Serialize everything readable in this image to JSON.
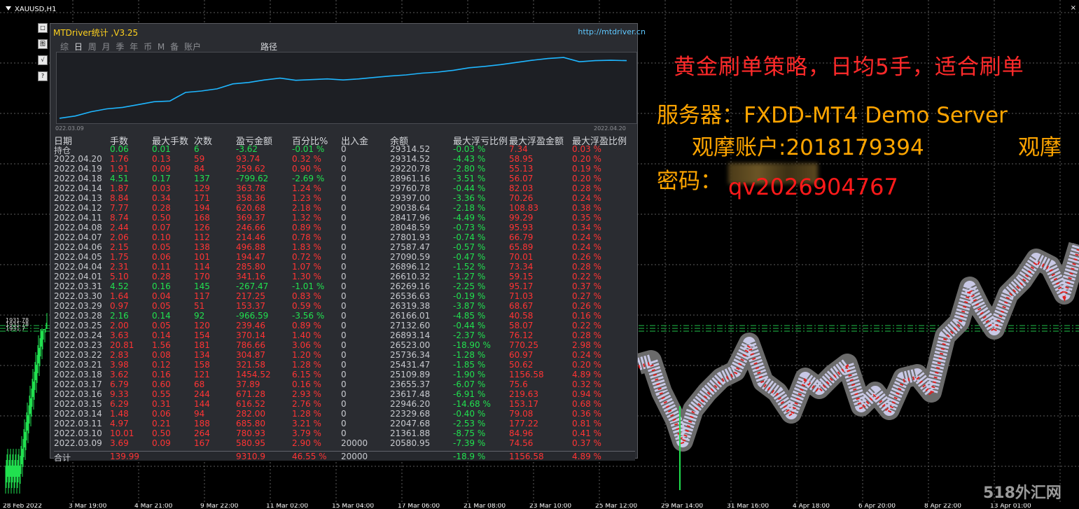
{
  "window": {
    "symbol_title": "XAUUSD,H1",
    "close": "×"
  },
  "side_buttons": [
    "□",
    "图",
    "√",
    "?"
  ],
  "panel": {
    "title": "MTDriver统计 ,V3.25",
    "link": "http://mtdriver.cn",
    "tabs": [
      "综",
      "日",
      "周",
      "月",
      "季",
      "年",
      "币",
      "M",
      "备",
      "账户"
    ],
    "active_tab": "日",
    "route_label": "路径",
    "equity_start": "022.03.09",
    "equity_end": "2022.04.20",
    "equity_curve": [
      20580,
      20900,
      21500,
      21900,
      22100,
      22500,
      22900,
      23000,
      24200,
      24400,
      24700,
      25400,
      25600,
      25950,
      26200,
      25900,
      26000,
      26100,
      25950,
      26100,
      26300,
      26500,
      26650,
      26900,
      27050,
      27300,
      27650,
      27850,
      28100,
      28400,
      28700,
      28950,
      29100,
      28500,
      28650,
      28700,
      28650
    ],
    "columns": [
      "日期",
      "手数",
      "最大手数",
      "次数",
      "盈亏金额",
      "百分比%",
      "出入金",
      "余额",
      "最大浮亏比例",
      "最大浮盈金额",
      "最大浮盈比例"
    ],
    "col_accent": "#ff3434",
    "col_positive": "#21e04f",
    "rows": [
      [
        "持仓",
        "0.06",
        "0.01",
        "6",
        "-3.62",
        "-0.01 %",
        "0",
        "29314.52",
        "-0.03 %",
        "7.34",
        "0.03 %",
        "g"
      ],
      [
        "2022.04.20",
        "1.76",
        "0.13",
        "59",
        "93.74",
        "0.32 %",
        "0",
        "29314.52",
        "-4.43 %",
        "58.95",
        "0.20 %",
        "r"
      ],
      [
        "2022.04.19",
        "1.91",
        "0.09",
        "84",
        "259.62",
        "0.90 %",
        "0",
        "29220.78",
        "-2.80 %",
        "55.13",
        "0.19 %",
        "r"
      ],
      [
        "2022.04.18",
        "4.51",
        "0.17",
        "137",
        "-799.62",
        "-2.69 %",
        "0",
        "28961.16",
        "-3.51 %",
        "56.07",
        "0.20 %",
        "g"
      ],
      [
        "2022.04.14",
        "1.87",
        "0.03",
        "129",
        "363.78",
        "1.24 %",
        "0",
        "29760.78",
        "-0.44 %",
        "82.03",
        "0.28 %",
        "r"
      ],
      [
        "2022.04.13",
        "8.84",
        "0.34",
        "171",
        "358.36",
        "1.23 %",
        "0",
        "29397.00",
        "-3.36 %",
        "70.26",
        "0.24 %",
        "r"
      ],
      [
        "2022.04.12",
        "7.77",
        "0.28",
        "194",
        "620.68",
        "2.18 %",
        "0",
        "29038.64",
        "-2.18 %",
        "108.83",
        "0.38 %",
        "r"
      ],
      [
        "2022.04.11",
        "8.74",
        "0.50",
        "168",
        "369.37",
        "1.32 %",
        "0",
        "28417.96",
        "-4.49 %",
        "99.29",
        "0.35 %",
        "r"
      ],
      [
        "2022.04.08",
        "2.44",
        "0.07",
        "126",
        "246.66",
        "0.89 %",
        "0",
        "28048.59",
        "-0.73 %",
        "95.93",
        "0.34 %",
        "r"
      ],
      [
        "2022.04.07",
        "2.06",
        "0.10",
        "112",
        "214.46",
        "0.78 %",
        "0",
        "27801.93",
        "-0.74 %",
        "66.79",
        "0.24 %",
        "r"
      ],
      [
        "2022.04.06",
        "2.15",
        "0.05",
        "138",
        "496.88",
        "1.83 %",
        "0",
        "27587.47",
        "-0.57 %",
        "65.89",
        "0.24 %",
        "r"
      ],
      [
        "2022.04.05",
        "1.75",
        "0.06",
        "101",
        "194.47",
        "0.72 %",
        "0",
        "27090.59",
        "-0.47 %",
        "70.01",
        "0.26 %",
        "r"
      ],
      [
        "2022.04.04",
        "2.31",
        "0.11",
        "114",
        "285.80",
        "1.07 %",
        "0",
        "26896.12",
        "-1.52 %",
        "73.34",
        "0.28 %",
        "r"
      ],
      [
        "2022.04.01",
        "5.10",
        "0.28",
        "170",
        "341.16",
        "1.30 %",
        "0",
        "26610.32",
        "-1.27 %",
        "59.15",
        "0.22 %",
        "r"
      ],
      [
        "2022.03.31",
        "4.52",
        "0.16",
        "145",
        "-267.47",
        "-1.01 %",
        "0",
        "26269.16",
        "-2.25 %",
        "95.17",
        "0.37 %",
        "g"
      ],
      [
        "2022.03.30",
        "1.64",
        "0.04",
        "117",
        "217.25",
        "0.83 %",
        "0",
        "26536.63",
        "-0.19 %",
        "71.03",
        "0.27 %",
        "r"
      ],
      [
        "2022.03.29",
        "0.97",
        "0.05",
        "51",
        "153.37",
        "0.59 %",
        "0",
        "26319.38",
        "-3.87 %",
        "68.67",
        "0.26 %",
        "r"
      ],
      [
        "2022.03.28",
        "2.16",
        "0.14",
        "92",
        "-966.59",
        "-3.56 %",
        "0",
        "26166.01",
        "-4.85 %",
        "40.58",
        "0.16 %",
        "g"
      ],
      [
        "2022.03.25",
        "2.00",
        "0.05",
        "120",
        "239.46",
        "0.89 %",
        "0",
        "27132.60",
        "-0.44 %",
        "58.07",
        "0.22 %",
        "r"
      ],
      [
        "2022.03.24",
        "3.63",
        "0.14",
        "154",
        "370.14",
        "1.40 %",
        "0",
        "26893.14",
        "-2.37 %",
        "76.12",
        "0.28 %",
        "r"
      ],
      [
        "2022.03.23",
        "20.81",
        "1.56",
        "181",
        "786.66",
        "3.06 %",
        "0",
        "26523.00",
        "-18.90 %",
        "770.25",
        "2.98 %",
        "r"
      ],
      [
        "2022.03.22",
        "2.83",
        "0.08",
        "134",
        "304.87",
        "1.20 %",
        "0",
        "25736.34",
        "-1.28 %",
        "60.97",
        "0.24 %",
        "r"
      ],
      [
        "2022.03.21",
        "3.98",
        "0.12",
        "158",
        "321.58",
        "1.28 %",
        "0",
        "25431.47",
        "-1.85 %",
        "50.62",
        "0.20 %",
        "r"
      ],
      [
        "2022.03.18",
        "3.62",
        "0.16",
        "121",
        "1454.52",
        "6.15 %",
        "0",
        "25109.89",
        "-1.90 %",
        "1156.58",
        "4.89 %",
        "r"
      ],
      [
        "2022.03.17",
        "6.79",
        "0.60",
        "68",
        "37.89",
        "0.16 %",
        "0",
        "23655.37",
        "-6.07 %",
        "75.6",
        "0.32 %",
        "r"
      ],
      [
        "2022.03.16",
        "9.33",
        "0.55",
        "244",
        "671.28",
        "2.93 %",
        "0",
        "23617.48",
        "-6.91 %",
        "219.63",
        "0.94 %",
        "r"
      ],
      [
        "2022.03.15",
        "6.29",
        "0.31",
        "144",
        "616.52",
        "2.76 %",
        "0",
        "22946.20",
        "-14.68 %",
        "153.17",
        "0.68 %",
        "r"
      ],
      [
        "2022.03.14",
        "1.48",
        "0.06",
        "94",
        "282.00",
        "1.28 %",
        "0",
        "22329.68",
        "-0.40 %",
        "79.08",
        "0.36 %",
        "r"
      ],
      [
        "2022.03.11",
        "4.97",
        "0.21",
        "188",
        "685.80",
        "3.21 %",
        "0",
        "22047.68",
        "-2.53 %",
        "177.22",
        "0.81 %",
        "r"
      ],
      [
        "2022.03.10",
        "10.01",
        "0.50",
        "264",
        "780.93",
        "3.79 %",
        "0",
        "21361.88",
        "-8.75 %",
        "84.96",
        "0.41 %",
        "r"
      ],
      [
        "2022.03.09",
        "3.69",
        "0.09",
        "167",
        "580.95",
        "2.90 %",
        "20000",
        "20580.95",
        "-7.39 %",
        "74.56",
        "0.37 %",
        "r"
      ]
    ],
    "total": [
      "合计",
      "139.99",
      "",
      "",
      "9310.9",
      "46.55 %",
      "20000",
      "",
      "-18.9 %",
      "1156.58",
      "4.89 %"
    ]
  },
  "promo": {
    "line1": "黄金刷单策略，日均5手，适合刷单",
    "line2": "服务器：FXDD-MT4 Demo Server",
    "line3": "观摩账户:2018179394",
    "line3b": "观摩",
    "line4": "密码：",
    "line5": "qv2026904767"
  },
  "watermark": "518外汇网",
  "time_axis": [
    "28 Feb 2022",
    "3 Mar 19:00",
    "4 Mar 21:00",
    "9 Mar 22:00",
    "11 Mar 02:00",
    "15 Mar 04:00",
    "17 Mar 06:00",
    "21 Mar 08:00",
    "23 Mar 10:00",
    "25 Mar 12:00",
    "29 Mar 14:00",
    "31 Mar 16:00",
    "4 Apr 18:00",
    "6 Apr 20:00",
    "8 Apr 22:00",
    "13 Apr 01:00"
  ],
  "price_tags": [
    "1931.78",
    "1931.78",
    "1931.7"
  ],
  "colors": {
    "bg": "#000000",
    "grid": "#6b6b6b",
    "green_bar": "#21e04f",
    "orange": "#ffa500",
    "red": "#ff2a2a"
  }
}
